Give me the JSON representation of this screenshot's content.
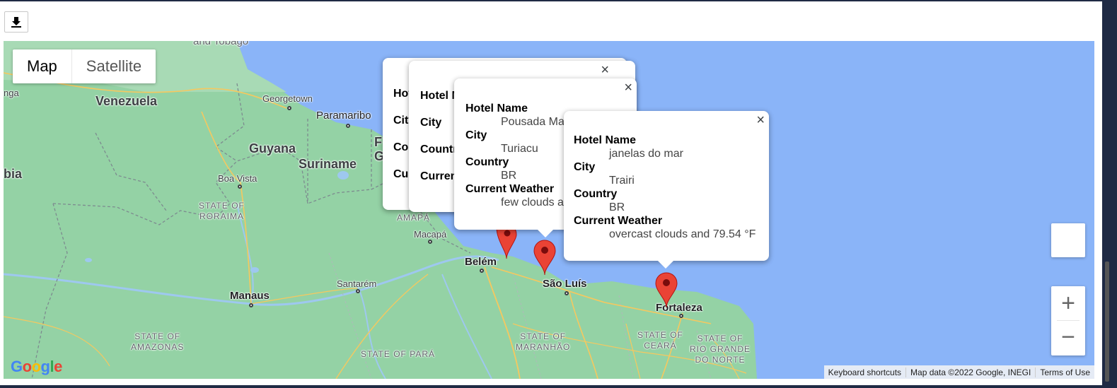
{
  "toolbar": {
    "download_icon": "download-icon"
  },
  "map_type": {
    "map_label": "Map",
    "satellite_label": "Satellite",
    "selected": "Map"
  },
  "labels": {
    "trinidad": "and Tobago",
    "venezuela": "Venezuela",
    "guyana": "Guyana",
    "suriname": "Suriname",
    "colombia": "bia",
    "anga": "nga",
    "georgetown": "Georgetown",
    "paramaribo": "Paramaribo",
    "fg1": "F",
    "fg2": "G",
    "boa_vista": "Boa Vista",
    "roraima": "STATE OF\nRORAIMA",
    "amapa": "AMAPÁ",
    "macapa": "Macapá",
    "belem": "Belém",
    "santarem": "Santarém",
    "manaus": "Manaus",
    "sao_luis": "São Luís",
    "fortaleza": "Fortaleza",
    "amazonas": "STATE OF\nAMAZONAS",
    "para": "STATE OF PARÁ",
    "maranhao": "STATE OF\nMARANHÃO",
    "ceara": "STATE OF\nCEARÁ",
    "rio_grande": "STATE OF\nRIO GRANDE\nDO NORTE"
  },
  "info_windows": [
    {
      "hotel_label": "Hot",
      "city_label": "City",
      "country_label": "Cou",
      "weather_label": "Cur"
    },
    {
      "hotel_label": "Hotel N",
      "city_label": "City",
      "country_label": "Countr",
      "weather_label": "Current"
    },
    {
      "hotel_label": "Hotel Name",
      "hotel": "Pousada Ma",
      "city_label": "City",
      "city": "Turiacu",
      "country_label": "Country",
      "country": "BR",
      "weather_label": "Current Weather",
      "weather": "few clouds a"
    },
    {
      "hotel_label": "Hotel Name",
      "hotel": "janelas do mar",
      "city_label": "City",
      "city": "Trairi",
      "country_label": "Country",
      "country": "BR",
      "weather_label": "Current Weather",
      "weather": "overcast clouds and 79.54 °F"
    }
  ],
  "close_glyph": "×",
  "zoom": {
    "in": "+",
    "out": "−"
  },
  "attribution": {
    "shortcuts": "Keyboard shortcuts",
    "data": "Map data ©2022 Google, INEGI",
    "terms": "Terms of Use"
  },
  "logo": "Google",
  "colors": {
    "ocean": "#8ab4f8",
    "land": "#94d2a5",
    "roads": "#f6c85f",
    "marker": "#ea4335"
  }
}
